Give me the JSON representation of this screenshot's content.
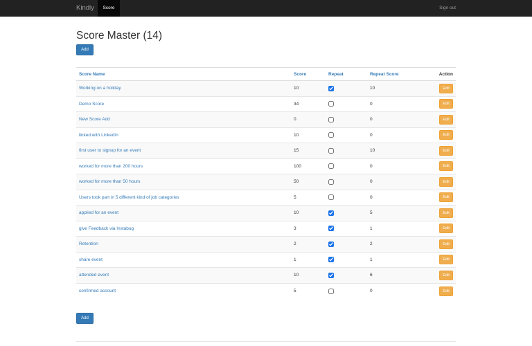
{
  "navbar": {
    "brand": "Kindly",
    "active_item": "Score",
    "sign_out": "Sign out"
  },
  "page": {
    "title": "Score Master (14)",
    "add_label": "Add"
  },
  "table": {
    "headers": {
      "name": "Score Name",
      "score": "Score",
      "repeat": "Repeat",
      "repeat_score": "Repeat Score",
      "action": "Action"
    },
    "edit_label": "Edit",
    "rows": [
      {
        "name": "Working on a holiday",
        "score": "10",
        "repeat": true,
        "repeat_score": "10"
      },
      {
        "name": "Demo Score",
        "score": "34",
        "repeat": false,
        "repeat_score": "0"
      },
      {
        "name": "New Score Add",
        "score": "0",
        "repeat": false,
        "repeat_score": "0"
      },
      {
        "name": "linked with LinkedIn",
        "score": "10",
        "repeat": false,
        "repeat_score": "0"
      },
      {
        "name": "first user to signup for an event",
        "score": "15",
        "repeat": false,
        "repeat_score": "10"
      },
      {
        "name": "worked for more than 200 hours",
        "score": "100",
        "repeat": false,
        "repeat_score": "0"
      },
      {
        "name": "worked for more than 50 hours",
        "score": "50",
        "repeat": false,
        "repeat_score": "0"
      },
      {
        "name": "Users took part in 5 different kind of job categories",
        "score": "5",
        "repeat": false,
        "repeat_score": "0"
      },
      {
        "name": "applied for an event",
        "score": "10",
        "repeat": true,
        "repeat_score": "5"
      },
      {
        "name": "give Feedback via Instabug",
        "score": "3",
        "repeat": true,
        "repeat_score": "1"
      },
      {
        "name": "Retention",
        "score": "2",
        "repeat": true,
        "repeat_score": "2"
      },
      {
        "name": "share event",
        "score": "1",
        "repeat": true,
        "repeat_score": "1"
      },
      {
        "name": "attended event",
        "score": "10",
        "repeat": true,
        "repeat_score": "6"
      },
      {
        "name": "confirmed account",
        "score": "5",
        "repeat": false,
        "repeat_score": "0"
      }
    ]
  },
  "colors": {
    "navbar_bg": "#222222",
    "primary": "#337ab7",
    "warning": "#f0ad4e"
  }
}
